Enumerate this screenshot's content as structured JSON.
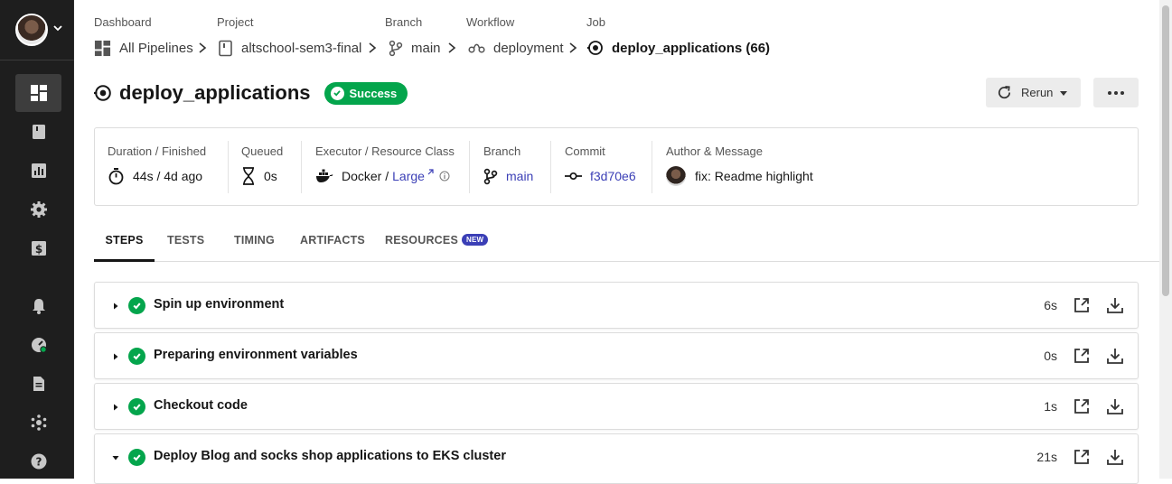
{
  "breadcrumb": {
    "labels": [
      "Dashboard",
      "Project",
      "Branch",
      "Workflow",
      "Job"
    ],
    "items": [
      {
        "text": "All Pipelines"
      },
      {
        "text": "altschool-sem3-final"
      },
      {
        "text": "main"
      },
      {
        "text": "deployment"
      },
      {
        "text": "deploy_applications (66)"
      }
    ]
  },
  "job": {
    "title": "deploy_applications",
    "status": "Success"
  },
  "actions": {
    "rerun_label": "Rerun"
  },
  "info": {
    "duration_label": "Duration / Finished",
    "duration_value": "44s / 4d ago",
    "queued_label": "Queued",
    "queued_value": "0s",
    "executor_label": "Executor / Resource Class",
    "executor_value": "Docker / ",
    "resource_class": "Large",
    "branch_label": "Branch",
    "branch_value": "main",
    "commit_label": "Commit",
    "commit_value": "f3d70e6",
    "author_label": "Author & Message",
    "author_message": "fix: Readme highlight"
  },
  "tabs": [
    {
      "label": "STEPS"
    },
    {
      "label": "TESTS"
    },
    {
      "label": "TIMING"
    },
    {
      "label": "ARTIFACTS"
    },
    {
      "label": "RESOURCES"
    }
  ],
  "new_badge": "NEW",
  "steps": [
    {
      "name": "Spin up environment",
      "duration": "6s"
    },
    {
      "name": "Preparing environment variables",
      "duration": "0s"
    },
    {
      "name": "Checkout code",
      "duration": "1s"
    },
    {
      "name": "Deploy Blog and socks shop applications to EKS cluster",
      "duration": "21s"
    }
  ],
  "colors": {
    "success": "#04a54c",
    "link": "#3b3fb6",
    "sidebar": "#1e1e1e"
  }
}
